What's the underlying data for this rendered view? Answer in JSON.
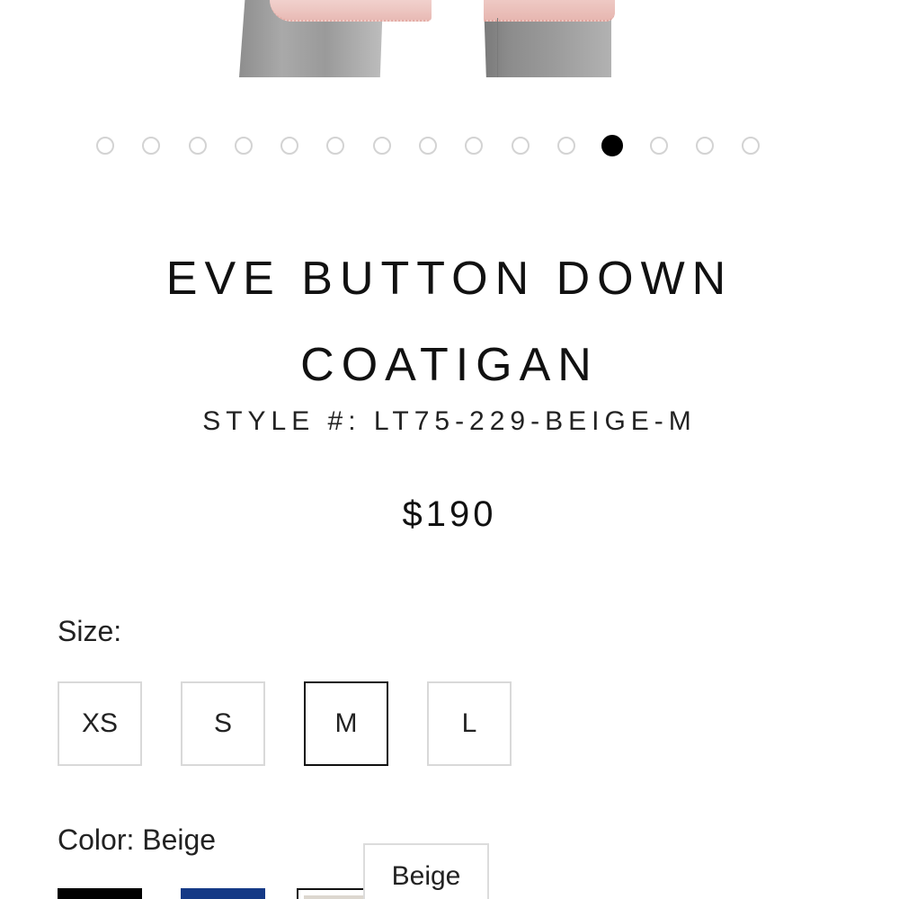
{
  "product": {
    "title_line1": "EVE BUTTON DOWN",
    "title_line2": "COATIGAN",
    "style_number": "STYLE #: LT75-229-BEIGE-M",
    "price": "$190"
  },
  "carousel": {
    "total_slides": 15,
    "active_index": 11
  },
  "size": {
    "label": "Size:",
    "options": [
      "XS",
      "S",
      "M",
      "L"
    ],
    "selected": "M"
  },
  "color": {
    "label": "Color: Beige",
    "selected": "Beige",
    "tooltip": "Beige",
    "swatches": [
      {
        "name": "Black",
        "hex": "#000000"
      },
      {
        "name": "Navy",
        "hex": "#153a86"
      },
      {
        "name": "Beige",
        "hex": "#dcd7cf"
      }
    ]
  }
}
